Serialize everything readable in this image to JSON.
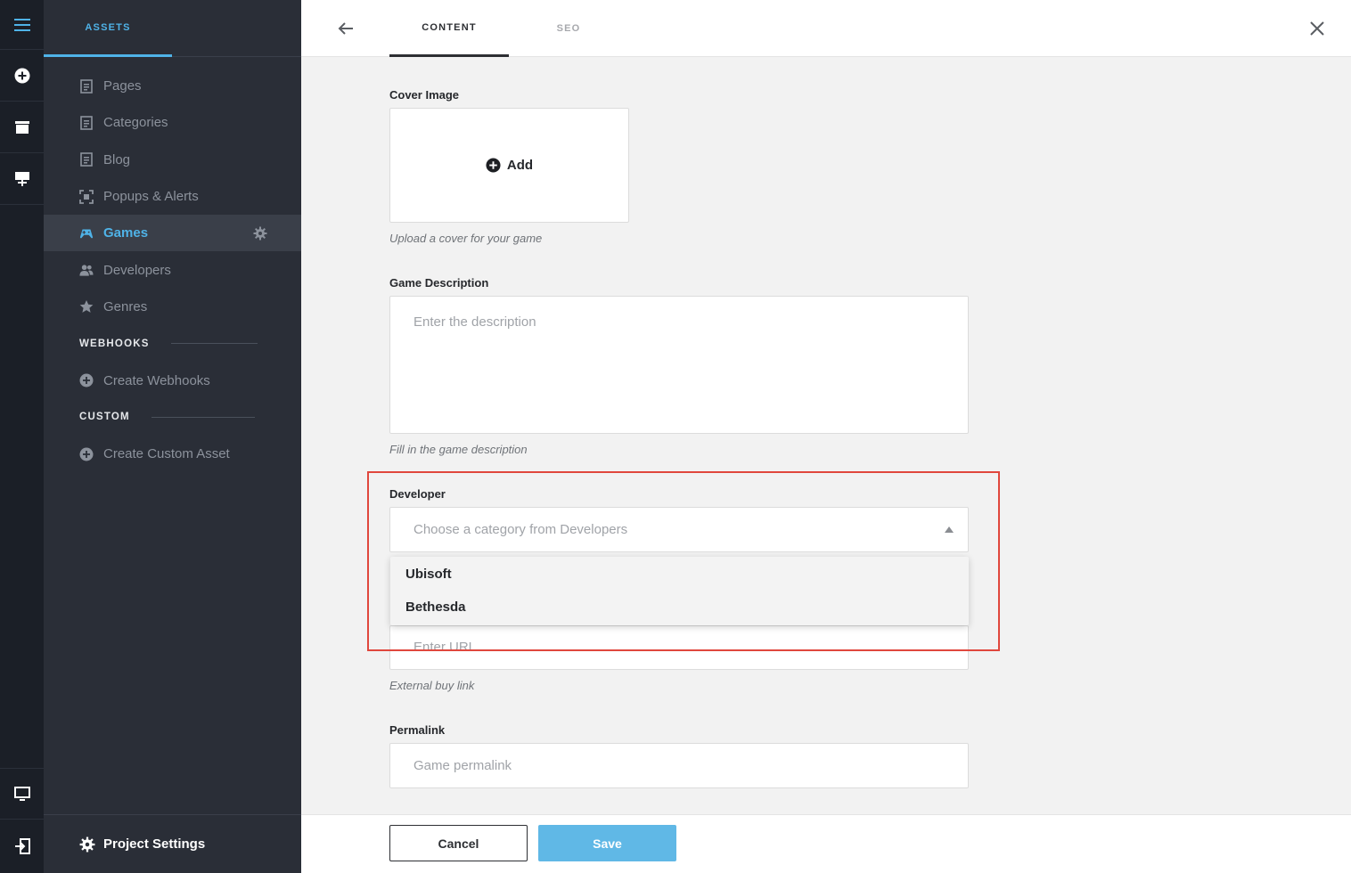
{
  "colors": {
    "accent": "#4fb3e8",
    "rail_bg": "#1b1f27",
    "sidebar_bg": "#2a2e37",
    "highlight": "#e0473d",
    "save_button": "#60b8e6"
  },
  "rail": {
    "icons": [
      "menu-icon",
      "add-circle-icon",
      "archive-box-icon",
      "easel-icon",
      "monitor-icon",
      "sign-out-icon"
    ]
  },
  "sidebar": {
    "tab": "ASSETS",
    "items": [
      {
        "label": "Pages",
        "icon": "page-icon"
      },
      {
        "label": "Categories",
        "icon": "page-icon"
      },
      {
        "label": "Blog",
        "icon": "page-icon"
      },
      {
        "label": "Popups & Alerts",
        "icon": "popup-frame-icon"
      },
      {
        "label": "Games",
        "icon": "gamepad-icon",
        "active": true
      },
      {
        "label": "Developers",
        "icon": "users-icon"
      },
      {
        "label": "Genres",
        "icon": "star-icon"
      }
    ],
    "webhooks_section": "WEBHOOKS",
    "create_webhooks": "Create Webhooks",
    "custom_section": "CUSTOM",
    "create_custom_asset": "Create Custom Asset",
    "project_settings": "Project Settings"
  },
  "header": {
    "tabs": [
      {
        "label": "CONTENT",
        "active": true
      },
      {
        "label": "SEO",
        "active": false
      }
    ]
  },
  "form": {
    "cover_image": {
      "label": "Cover Image",
      "add_label": "Add",
      "hint": "Upload a cover for your game"
    },
    "description": {
      "label": "Game Description",
      "placeholder": "Enter the description",
      "hint": "Fill in the game description"
    },
    "developer": {
      "label": "Developer",
      "placeholder": "Choose a category from Developers",
      "options": [
        "Ubisoft",
        "Bethesda"
      ],
      "expanded": true
    },
    "buy_link": {
      "placeholder": "Enter URL",
      "hint": "External buy link"
    },
    "permalink": {
      "label": "Permalink",
      "placeholder": "Game permalink"
    }
  },
  "footer": {
    "cancel_label": "Cancel",
    "save_label": "Save"
  }
}
